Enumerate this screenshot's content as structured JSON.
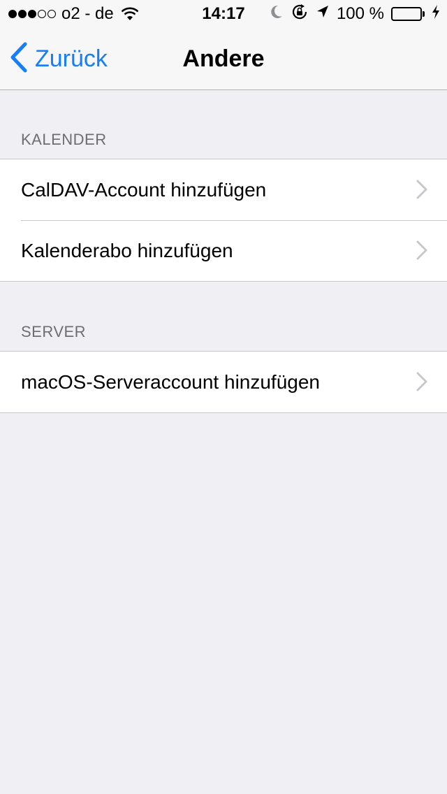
{
  "status_bar": {
    "carrier": "o2 - de",
    "time": "14:17",
    "battery_percent": "100 %",
    "signal_strength": 3,
    "signal_total": 5,
    "battery_level": 1.0,
    "battery_color": "#4cd964",
    "icons": [
      "wifi-icon",
      "moon-icon",
      "rotation-lock-icon",
      "location-arrow-icon",
      "battery-icon",
      "charging-bolt-icon"
    ]
  },
  "nav": {
    "back_label": "Zurück",
    "title": "Andere",
    "accent_color": "#147efb"
  },
  "sections": [
    {
      "header": "KALENDER",
      "items": [
        {
          "label": "CalDAV-Account hinzufügen"
        },
        {
          "label": "Kalenderabo hinzufügen"
        }
      ]
    },
    {
      "header": "SERVER",
      "items": [
        {
          "label": "macOS-Serveraccount hinzufügen"
        }
      ]
    }
  ]
}
